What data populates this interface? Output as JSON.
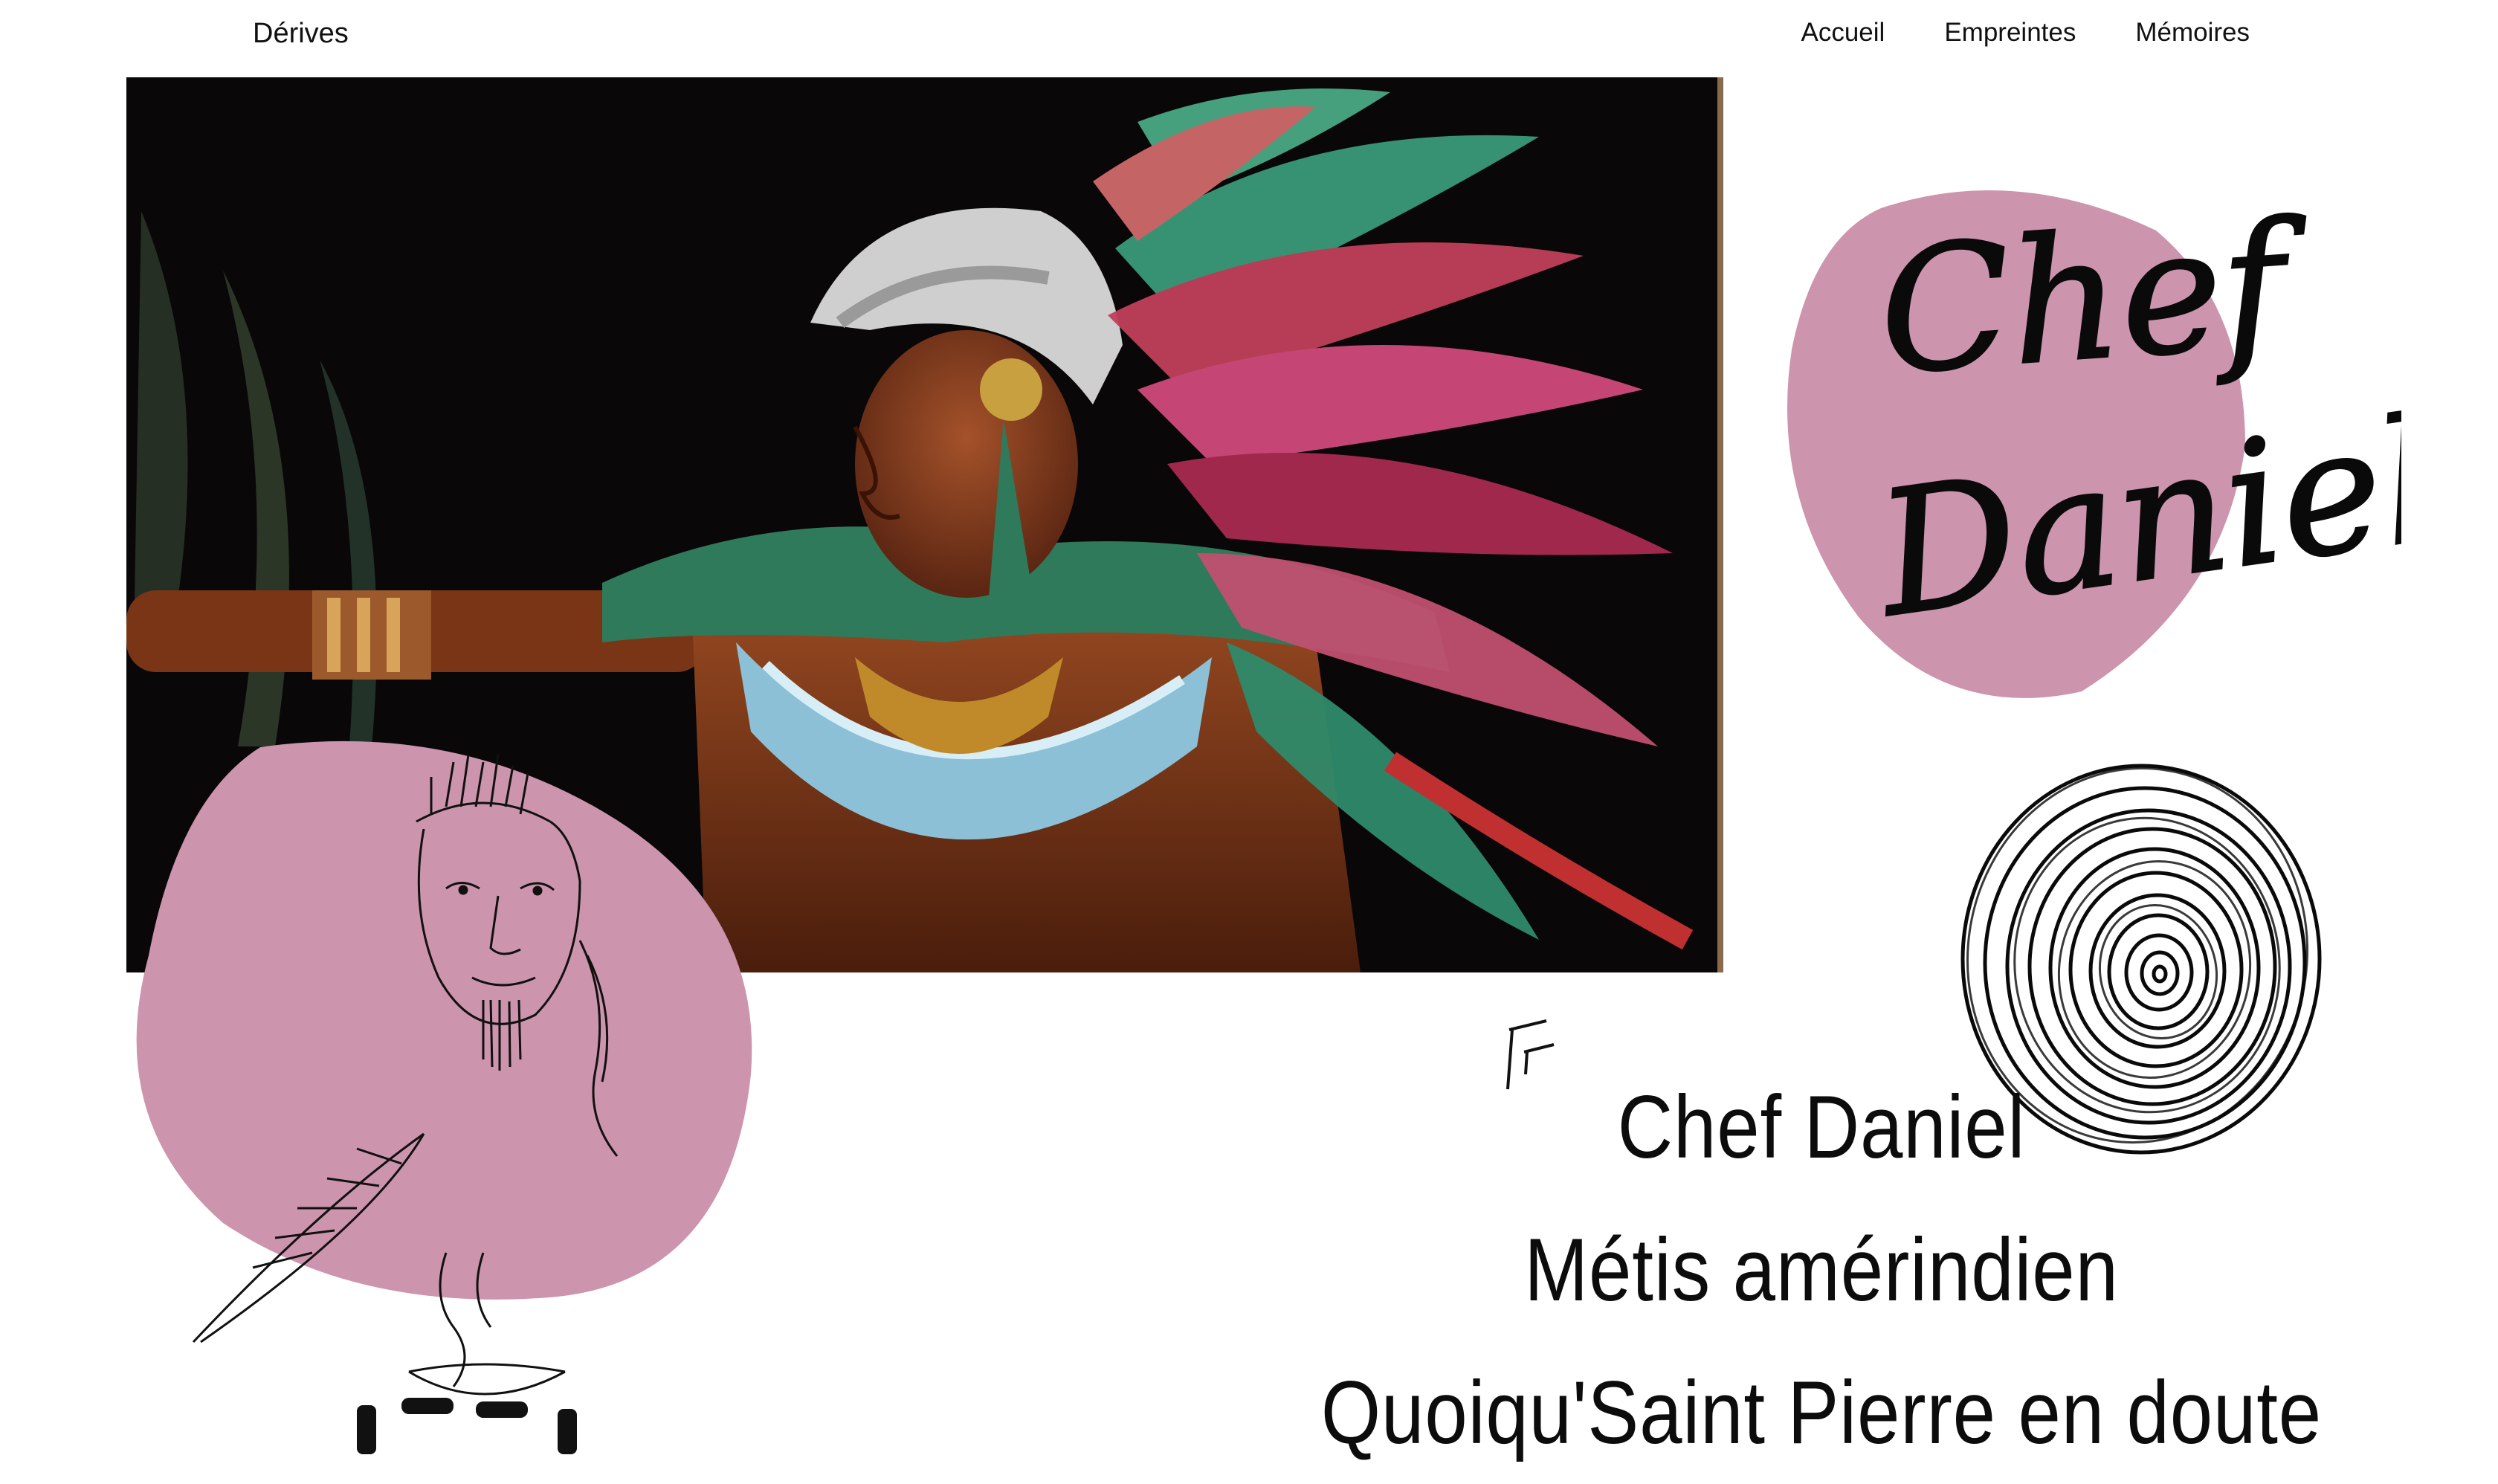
{
  "nav": {
    "brand": "Dérives",
    "items": [
      {
        "label": "Accueil"
      },
      {
        "label": "Empreintes"
      },
      {
        "label": "Mémoires"
      }
    ]
  },
  "logo": {
    "line1": "Chef",
    "line2": "Daniel"
  },
  "intro": {
    "line1": "Chef Daniel",
    "line2": "Métis amérindien",
    "line3": "Quoiqu'Saint Pierre en doute"
  },
  "colors": {
    "blob": "#cc94ad",
    "ink": "#111111",
    "background": "#ffffff",
    "painting_bg": "#0a0708"
  },
  "icons": {
    "portrait": "sketch-chef-portrait",
    "spiral": "spiral-scribble",
    "quote": "quote-mark-glyph"
  }
}
